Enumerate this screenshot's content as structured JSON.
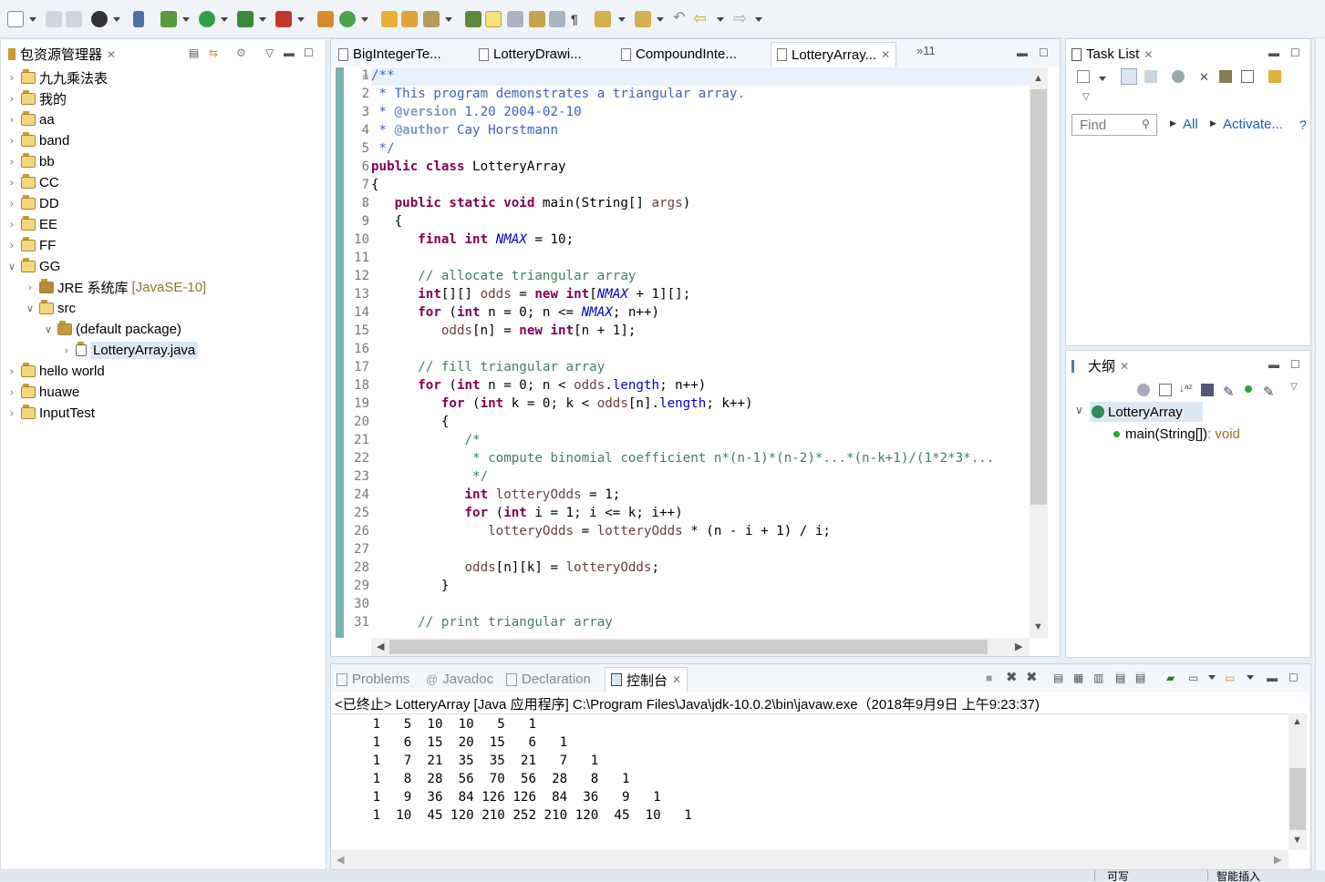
{
  "package_explorer": {
    "title": "包资源管理器",
    "items": [
      {
        "label": "九九乘法表",
        "depth": 0,
        "expanded": false
      },
      {
        "label": "我的",
        "depth": 0,
        "expanded": false
      },
      {
        "label": "aa",
        "depth": 0,
        "expanded": false
      },
      {
        "label": "band",
        "depth": 0,
        "expanded": false
      },
      {
        "label": "bb",
        "depth": 0,
        "expanded": false
      },
      {
        "label": "CC",
        "depth": 0,
        "expanded": false
      },
      {
        "label": "DD",
        "depth": 0,
        "expanded": false
      },
      {
        "label": "EE",
        "depth": 0,
        "expanded": false
      },
      {
        "label": "FF",
        "depth": 0,
        "expanded": false
      },
      {
        "label": "GG",
        "depth": 0,
        "expanded": true
      },
      {
        "label": "JRE 系统库",
        "suffix": "[JavaSE-10]",
        "depth": 1,
        "expanded": false
      },
      {
        "label": "src",
        "depth": 1,
        "expanded": true
      },
      {
        "label": "(default package)",
        "depth": 2,
        "expanded": true
      },
      {
        "label": "LotteryArray.java",
        "depth": 3,
        "expanded": false,
        "selected": true
      },
      {
        "label": "hello world",
        "depth": 0,
        "expanded": false
      },
      {
        "label": "huawe",
        "depth": 0,
        "expanded": false
      },
      {
        "label": "InputTest",
        "depth": 0,
        "expanded": false
      }
    ]
  },
  "editor": {
    "tabs": [
      "BigIntegerTe...",
      "LotteryDrawi...",
      "CompoundInte...",
      "LotteryArray..."
    ],
    "active_tab": 3,
    "overflow": "»11",
    "line_numbers": [
      "1",
      "2",
      "3",
      "4",
      "5",
      "6",
      "7",
      "8",
      "9",
      "10",
      "11",
      "12",
      "13",
      "14",
      "15",
      "16",
      "17",
      "18",
      "19",
      "20",
      "21",
      "22",
      "23",
      "24",
      "25",
      "26",
      "27",
      "28",
      "29",
      "30",
      "31"
    ],
    "lines": [
      "/**",
      " * This program demonstrates a triangular array.",
      " * @version 1.20 2004-02-10",
      " * @author Cay Horstmann",
      " */",
      "public class LotteryArray",
      "{",
      "   public static void main(String[] args)",
      "   {",
      "      final int NMAX = 10;",
      "",
      "      // allocate triangular array",
      "      int[][] odds = new int[NMAX + 1][];",
      "      for (int n = 0; n <= NMAX; n++)",
      "         odds[n] = new int[n + 1];",
      "",
      "      // fill triangular array",
      "      for (int n = 0; n < odds.length; n++)",
      "         for (int k = 0; k < odds[n].length; k++)",
      "         {",
      "            /*",
      "             * compute binomial coefficient n*(n-1)*(n-2)*...*(n-k+1)/(1*2*3*...",
      "             */",
      "            int lotteryOdds = 1;",
      "            for (int i = 1; i <= k; i++)",
      "               lotteryOdds = lotteryOdds * (n - i + 1) / i;",
      "",
      "            odds[n][k] = lotteryOdds;",
      "         }",
      "",
      "      // print triangular array"
    ]
  },
  "task_list": {
    "title": "Task List",
    "find_placeholder": "Find",
    "all_label": "All",
    "activate_label": "Activate..."
  },
  "outline": {
    "title": "大纲",
    "class_name": "LotteryArray",
    "method": "main(String[])",
    "method_type": " : void"
  },
  "console": {
    "tabs": [
      "Problems",
      "Javadoc",
      "Declaration",
      "控制台"
    ],
    "active_tab": 3,
    "header": "<已终止> LotteryArray [Java 应用程序] C:\\Program Files\\Java\\jdk-10.0.2\\bin\\javaw.exe（2018年9月9日 上午9:23:37)",
    "output": [
      "   1   5  10  10   5   1",
      "   1   6  15  20  15   6   1",
      "   1   7  21  35  35  21   7   1",
      "   1   8  28  56  70  56  28   8   1",
      "   1   9  36  84 126 126  84  36   9   1",
      "   1  10  45 120 210 252 210 120  45  10   1"
    ]
  },
  "status_bar": {
    "writable": "可写",
    "insert_mode": "智能插入"
  },
  "colors": {
    "keyword": "#7f0055",
    "comment": "#3f7f5f",
    "javadoc": "#3f5fbf",
    "field": "#0000c0",
    "selection": "#dde8f5"
  }
}
